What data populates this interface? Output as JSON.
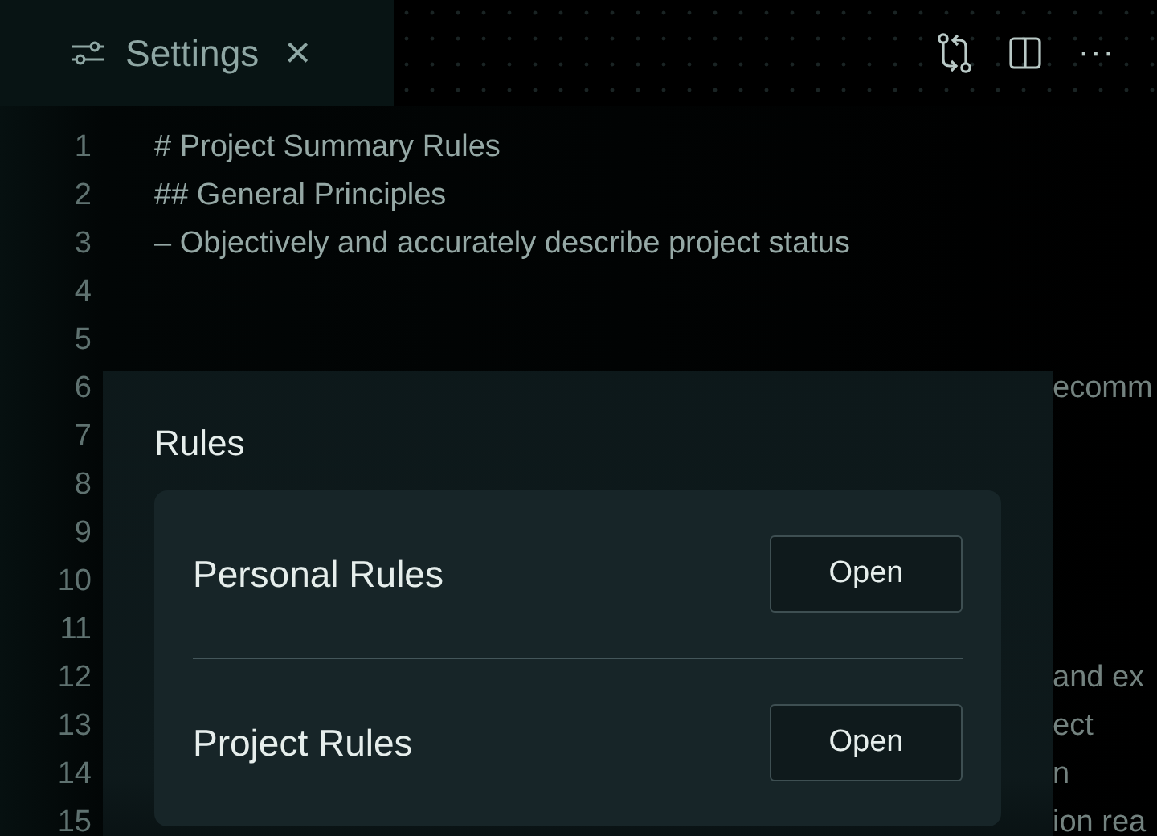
{
  "tab": {
    "title": "Settings",
    "close": "×"
  },
  "toolbar": {
    "more": "···"
  },
  "editor": {
    "lines": [
      {
        "number": "1",
        "text": "# Project Summary Rules"
      },
      {
        "number": "2",
        "text": "## General Principles"
      },
      {
        "number": "3",
        "text": "– Objectively and accurately describe project status"
      },
      {
        "number": "4"
      },
      {
        "number": "5"
      },
      {
        "number": "6",
        "tail": "ecomm"
      },
      {
        "number": "7"
      },
      {
        "number": "8"
      },
      {
        "number": "9"
      },
      {
        "number": "10"
      },
      {
        "number": "11"
      },
      {
        "number": "12",
        "tail": "and ex"
      },
      {
        "number": "13",
        "tail": "ect"
      },
      {
        "number": "14",
        "tail": "n"
      },
      {
        "number": "15",
        "tail": "ion rea"
      }
    ]
  },
  "rules": {
    "heading": "Rules",
    "items": [
      {
        "label": "Personal Rules",
        "button": "Open"
      },
      {
        "label": "Project Rules",
        "button": "Open"
      }
    ]
  }
}
